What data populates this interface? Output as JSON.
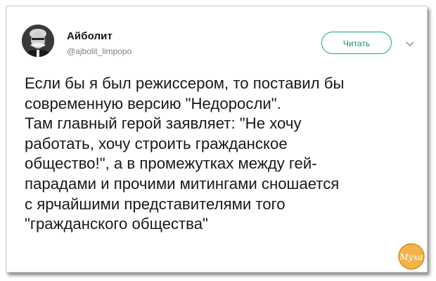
{
  "tweet": {
    "author_name": "Айболит",
    "author_handle": "@ajbolit_limpopo",
    "follow_label": "Читать",
    "text_lines": [
      "Если бы я был режиссером, то поставил бы",
      "современную версию \"Недоросли\".",
      "Там главный герой заявляет: \"Не хочу",
      "работать, хочу строить гражданское",
      "общество!\", а в промежутках между гей-",
      "парадами и прочими митингами сношается",
      "с ярчайшими представителями того",
      "\"гражданского общества\""
    ]
  },
  "watermark": {
    "text": "Муха"
  },
  "colors": {
    "accent": "#19a974",
    "text": "#16191c",
    "muted": "#7a8590",
    "logo": "#e8a23a"
  },
  "icons": {
    "menu": "chevron-down-icon"
  }
}
